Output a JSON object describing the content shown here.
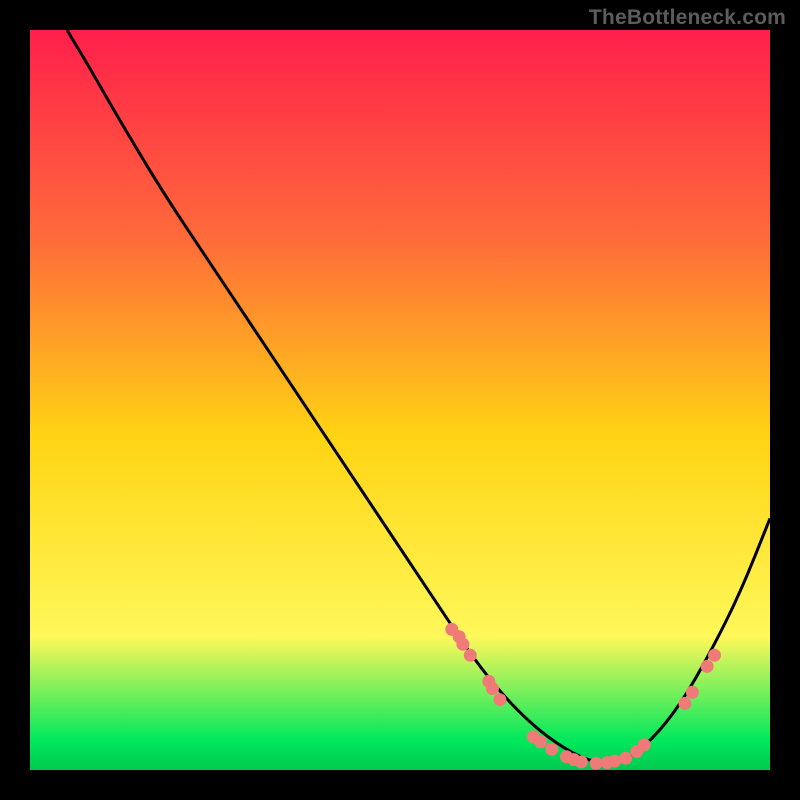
{
  "watermark": "TheBottleneck.com",
  "colors": {
    "bg": "#000000",
    "grad_top": "#ff1f4b",
    "grad_upper": "#ff6a3a",
    "grad_mid": "#ffd413",
    "grad_lower": "#fff85a",
    "grad_bottom": "#00e85c",
    "grad_bottom2": "#00c94f",
    "curve": "#000000",
    "dot": "#f07a78"
  },
  "chart_data": {
    "type": "line",
    "title": "",
    "xlabel": "",
    "ylabel": "",
    "xlim": [
      0,
      100
    ],
    "ylim": [
      0,
      100
    ],
    "series": [
      {
        "name": "curve",
        "x": [
          5,
          8,
          12,
          18,
          24,
          30,
          36,
          42,
          48,
          52,
          56,
          60,
          64,
          68,
          72,
          76,
          80,
          84,
          88,
          92,
          96,
          100
        ],
        "y": [
          100,
          95,
          88,
          78,
          69,
          60,
          51,
          42,
          33,
          27,
          21,
          15,
          10,
          6,
          3,
          1,
          1,
          4,
          9,
          16,
          24,
          34
        ]
      }
    ],
    "scatter": {
      "name": "highlight-dots",
      "points": [
        [
          57,
          19
        ],
        [
          58,
          18
        ],
        [
          58.5,
          17
        ],
        [
          59.5,
          15.5
        ],
        [
          62,
          12
        ],
        [
          62.5,
          11
        ],
        [
          63.5,
          9.5
        ],
        [
          68,
          4.5
        ],
        [
          69,
          3.8
        ],
        [
          70.5,
          2.8
        ],
        [
          72.5,
          1.8
        ],
        [
          73.5,
          1.4
        ],
        [
          74.5,
          1.1
        ],
        [
          76.5,
          0.9
        ],
        [
          78,
          1.0
        ],
        [
          79,
          1.2
        ],
        [
          80.5,
          1.6
        ],
        [
          82,
          2.5
        ],
        [
          83,
          3.4
        ],
        [
          88.5,
          9
        ],
        [
          89.5,
          10.5
        ],
        [
          91.5,
          14
        ],
        [
          92.5,
          15.5
        ]
      ]
    }
  }
}
